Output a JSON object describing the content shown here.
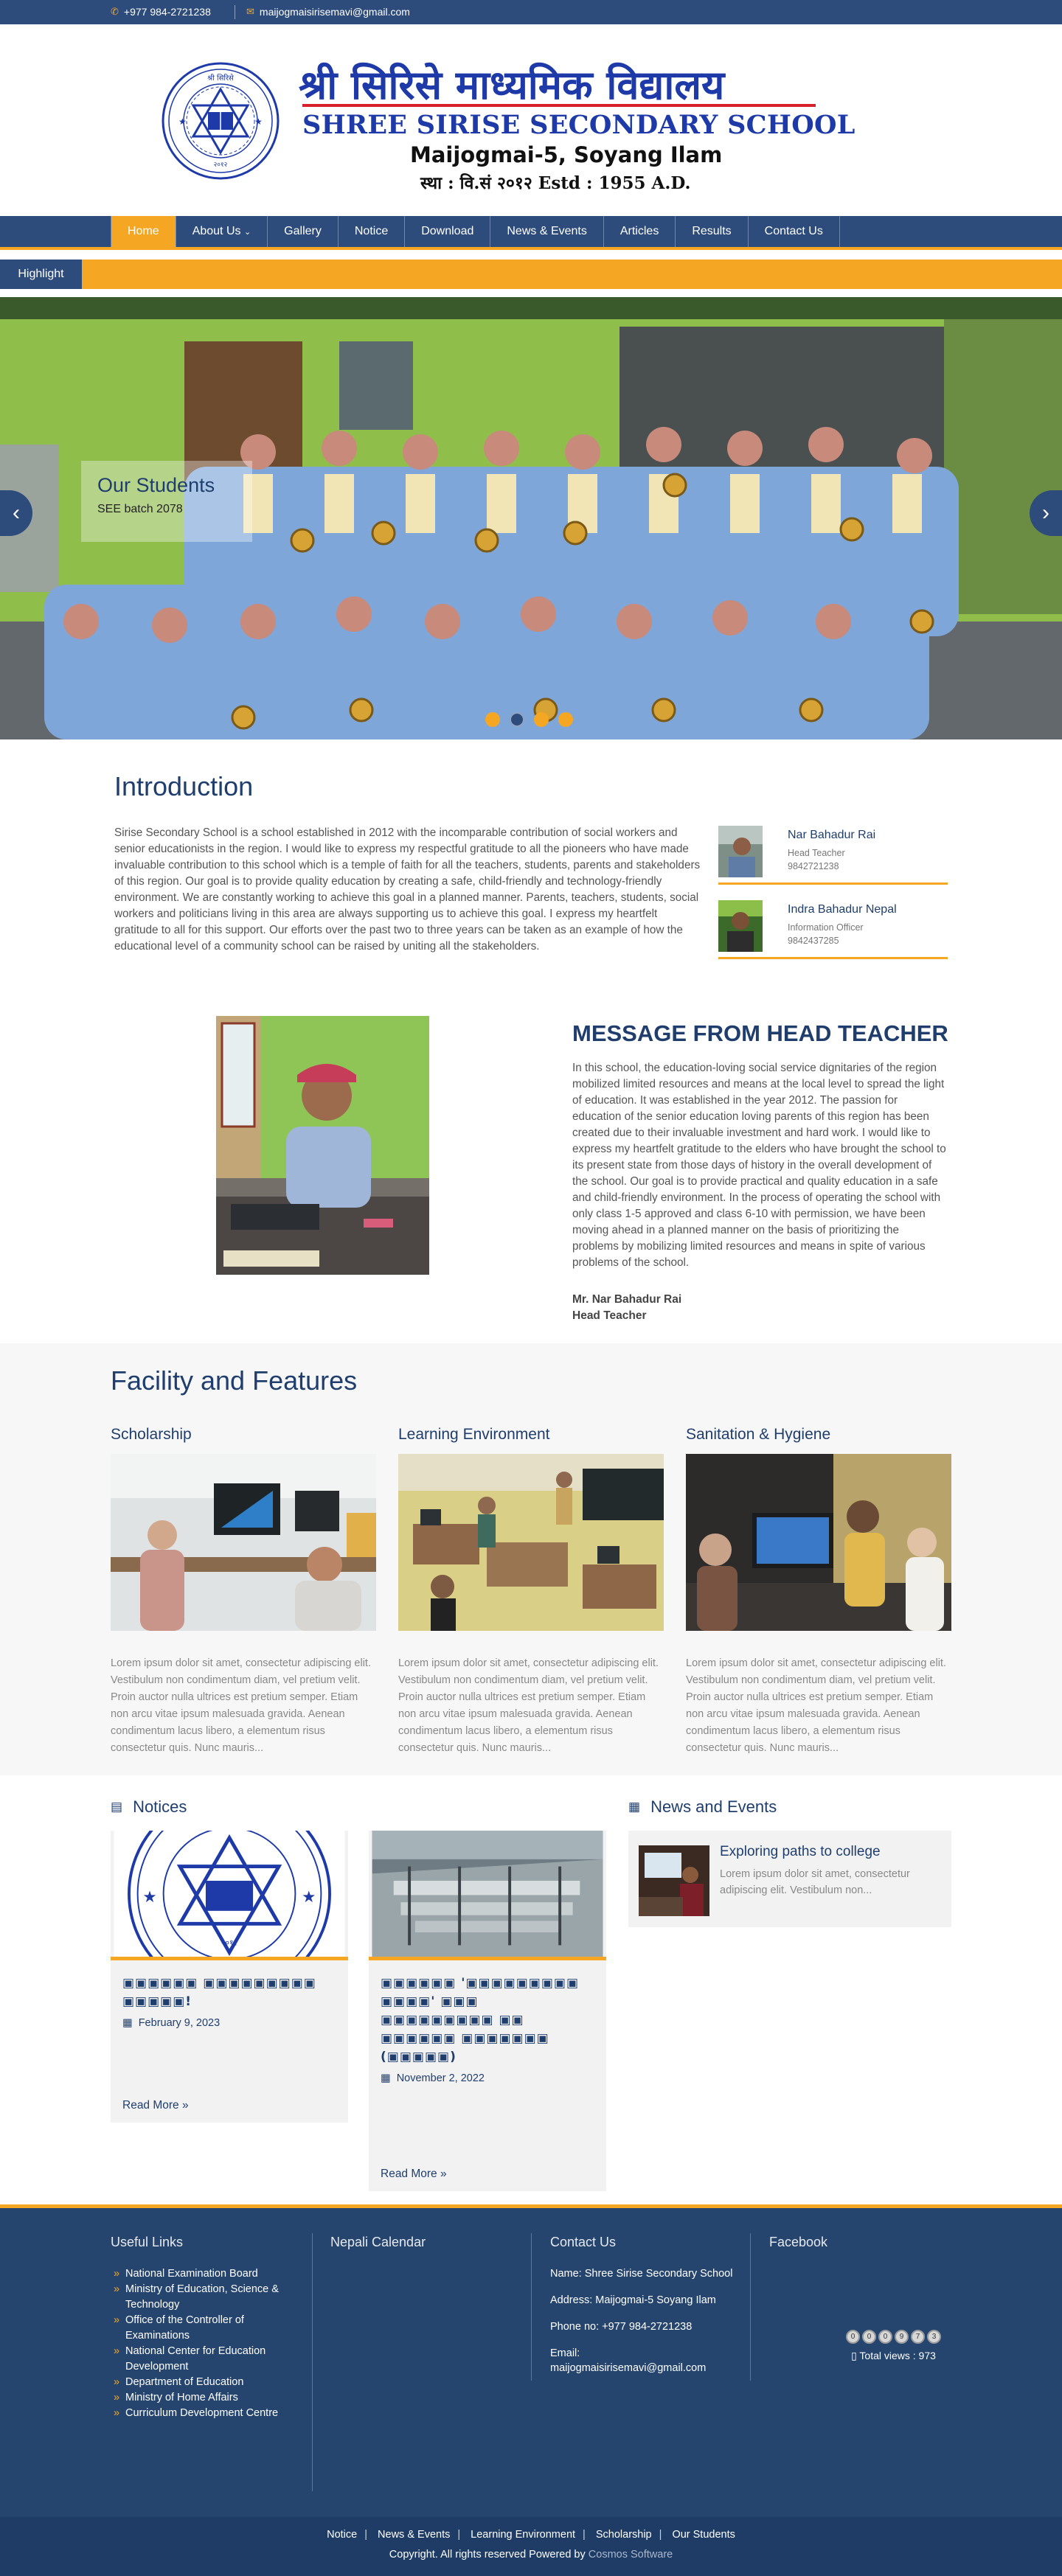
{
  "topbar": {
    "phone": "+977 984-2721238",
    "email": "maijogmaisirisemavi@gmail.com"
  },
  "header": {
    "name_nepali": "श्री सिरिसे माध्यमिक विद्यालय",
    "name_english": "SHREE SIRISE SECONDARY SCHOOL",
    "location": "Maijogmai-5, Soyang Ilam",
    "established": "स्था : वि.सं २०१२  Estd : 1955 A.D."
  },
  "nav": {
    "items": [
      "Home",
      "About Us",
      "Gallery",
      "Notice",
      "Download",
      "News & Events",
      "Articles",
      "Results",
      "Contact Us"
    ],
    "active": "Home"
  },
  "highlight": {
    "label": "Highlight"
  },
  "slider": {
    "title": "Our Students",
    "subtitle": "SEE batch 2078",
    "slides": 4,
    "active_slide": 2
  },
  "intro": {
    "heading": "Introduction",
    "text": "Sirise Secondary School is a school established in 2012 with the incomparable contribution of social workers and senior educationists in the region. I would like to express my respectful gratitude to all the pioneers who have made invaluable contribution to this school which is a temple of faith for all the teachers, students, parents and stakeholders of this region. Our goal is to provide quality education by creating a safe, child-friendly and technology-friendly environment. We are constantly working to achieve this goal in a planned manner. Parents, teachers, students, social workers and politicians living in this area are always supporting us to achieve this goal. I express my heartfelt gratitude to all for this support. Our efforts over the past two to three years can be taken as an example of how the educational level of a community school can be raised by uniting all the stakeholders.",
    "staff": [
      {
        "name": "Nar Bahadur Rai",
        "role": "Head Teacher",
        "phone": "9842721238"
      },
      {
        "name": "Indra Bahadur Nepal",
        "role": "Information Officer",
        "phone": "9842437285"
      }
    ]
  },
  "message": {
    "heading": "MESSAGE FROM HEAD TEACHER",
    "text": "In this school, the education-loving social service dignitaries of the region mobilized limited resources and means at the local level to spread the light of education. It was established in the year 2012. The passion for education of the senior education loving parents of this region has been created due to their invaluable investment and hard work. I would like to express my heartfelt gratitude to the elders who have brought the school to its present state from those days of history in the overall development of the school. Our goal is to provide practical and quality education in a safe and child-friendly environment. In the process of operating the school with only class 1-5 approved and class 6-10 with permission, we have been moving ahead in a planned manner on the basis of prioritizing the problems by mobilizing limited resources and means in spite of various problems of the school.",
    "signer": "Mr. Nar Bahadur Rai",
    "signer_role": "Head Teacher"
  },
  "facility": {
    "heading": "Facility and Features",
    "cards": [
      {
        "title": "Scholarship",
        "text": "Lorem ipsum dolor sit amet, consectetur adipiscing elit. Vestibulum non condimentum diam, vel pretium velit. Proin auctor nulla ultrices est pretium semper. Etiam non arcu vitae ipsum malesuada gravida. Aenean condimentum lacus libero, a elementum risus consectetur quis. Nunc mauris..."
      },
      {
        "title": "Learning Environment",
        "text": "Lorem ipsum dolor sit amet, consectetur adipiscing elit. Vestibulum non condimentum diam, vel pretium velit. Proin auctor nulla ultrices est pretium semper. Etiam non arcu vitae ipsum malesuada gravida. Aenean condimentum lacus libero, a elementum risus consectetur quis. Nunc mauris..."
      },
      {
        "title": "Sanitation & Hygiene",
        "text": "Lorem ipsum dolor sit amet, consectetur adipiscing elit. Vestibulum non condimentum diam, vel pretium velit. Proin auctor nulla ultrices est pretium semper. Etiam non arcu vitae ipsum malesuada gravida. Aenean condimentum lacus libero, a elementum risus consectetur quis. Nunc mauris..."
      }
    ]
  },
  "notices": {
    "heading": "Notices",
    "items": [
      {
        "title": "▣▣▣▣▣▣ ▣▣▣▣▣▣▣▣▣ ▣▣▣▣▣!",
        "date": "February 9, 2023",
        "read_more": "Read More"
      },
      {
        "title": "▣▣▣▣▣▣ '▣▣▣▣▣▣▣▣▣ ▣▣▣▣' ▣▣▣ ▣▣▣▣▣▣▣▣▣ ▣▣ ▣▣▣▣▣▣ ▣▣▣▣▣▣▣ (▣▣▣▣▣)",
        "date": "November 2, 2022",
        "read_more": "Read More"
      }
    ]
  },
  "news": {
    "heading": "News and Events",
    "items": [
      {
        "title": "Exploring paths to college",
        "text": "Lorem ipsum dolor sit amet, consectetur adipiscing elit. Vestibulum non..."
      }
    ]
  },
  "footer": {
    "useful_links": {
      "heading": "Useful Links",
      "items": [
        "National Examination Board",
        "Ministry of Education, Science & Technology",
        "Office of the Controller of Examinations",
        "National Center for Education Development",
        "Department of Education",
        "Ministry of Home Affairs",
        "Curriculum Development Centre"
      ]
    },
    "calendar": {
      "heading": "Nepali Calendar"
    },
    "contact": {
      "heading": "Contact Us",
      "name": "Name: Shree Sirise Secondary School",
      "address": "Address: Maijogmai-5 Soyang Ilam",
      "phone": "Phone no: +977 984-2721238",
      "email_label": "Email:",
      "email": "maijogmaisirisemavi@gmail.com"
    },
    "facebook": {
      "heading": "Facebook"
    },
    "counter": {
      "digits": [
        "0",
        "0",
        "0",
        "9",
        "7",
        "3"
      ],
      "label": "Total views : 973"
    },
    "bottom_links": [
      "Notice",
      "News & Events",
      "Learning Environment",
      "Scholarship",
      "Our Students"
    ],
    "copyright": "Copyright. All rights reserved Powered by",
    "powered_by": "Cosmos Software"
  }
}
